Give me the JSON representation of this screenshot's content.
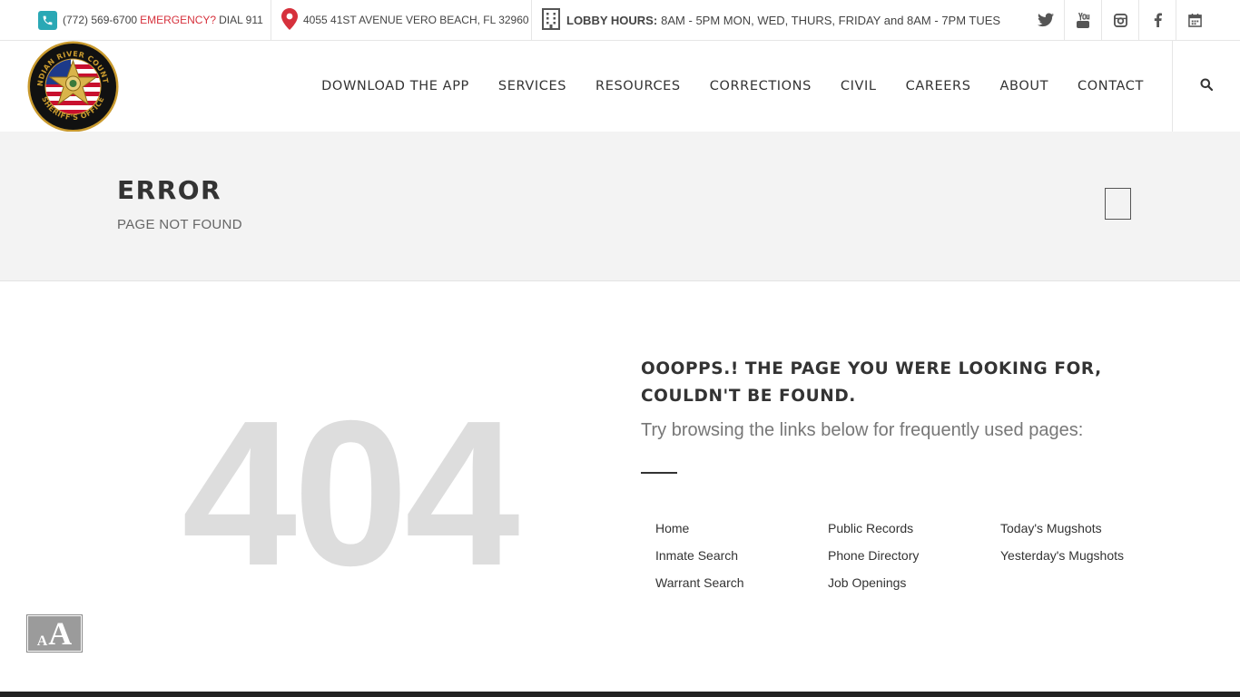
{
  "topbar": {
    "phone": "(772) 569-6700",
    "emergency_label": "EMERGENCY?",
    "emergency_action": "DIAL 911",
    "address": "4055 41ST AVENUE VERO BEACH, FL 32960",
    "hours_label": "LOBBY HOURS:",
    "hours_text": "8AM - 5PM MON, WED, THURS, FRIDAY and 8AM - 7PM TUES",
    "social_icons": [
      "twitter-icon",
      "youtube-icon",
      "instagram-icon",
      "facebook-icon",
      "calendar-icon"
    ]
  },
  "header": {
    "logo_alt": "Indian River County Sheriff's Office",
    "logo_text_top": "INDIAN RIVER COUNTY",
    "logo_text_bottom": "SHERIFF'S OFFICE",
    "nav": [
      {
        "label": "DOWNLOAD THE APP"
      },
      {
        "label": "SERVICES"
      },
      {
        "label": "RESOURCES"
      },
      {
        "label": "CORRECTIONS"
      },
      {
        "label": "CIVIL"
      },
      {
        "label": "CAREERS"
      },
      {
        "label": "ABOUT"
      },
      {
        "label": "CONTACT"
      }
    ],
    "search_icon": "search-icon"
  },
  "titlebar": {
    "title": "ERROR",
    "subtitle": "PAGE NOT FOUND"
  },
  "main": {
    "big_code": "404",
    "heading": "OOOPPS.! THE PAGE YOU WERE LOOKING FOR, COULDN'T BE FOUND.",
    "subheading": "Try browsing the links below for frequently used pages:",
    "links": [
      "Home",
      "Public Records",
      "Today's Mugshots",
      "Inmate Search",
      "Phone Directory",
      "Yesterday's Mugshots",
      "Warrant Search",
      "Job Openings"
    ]
  },
  "accessibility": {
    "small_letter": "A",
    "large_letter": "A"
  },
  "colors": {
    "accent_teal": "#2aa8b5",
    "emergency_red": "#d6313c",
    "pin_red": "#d6313c",
    "title_band": "#f3f3f3",
    "big_code": "#dddddd"
  }
}
